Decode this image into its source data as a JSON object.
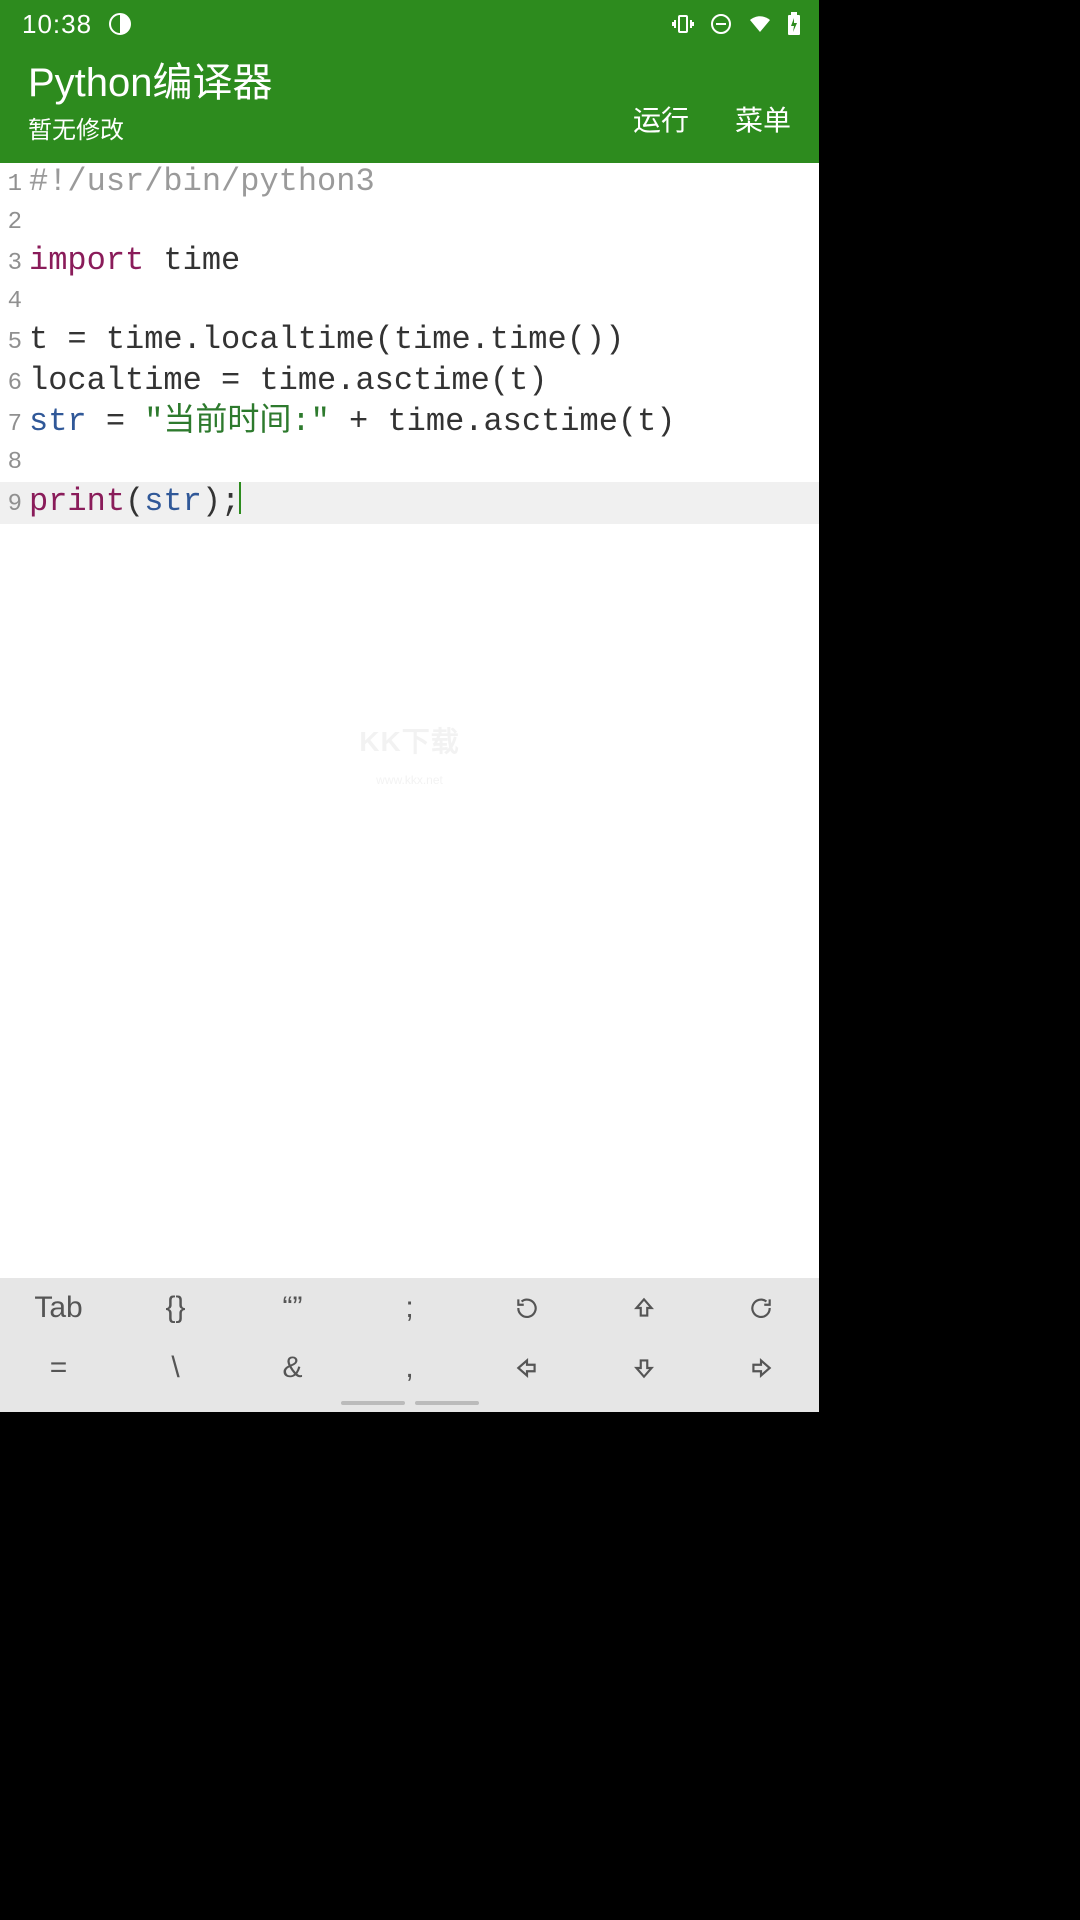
{
  "status": {
    "time": "10:38"
  },
  "header": {
    "title": "Python编译器",
    "subtitle": "暂无修改",
    "run": "运行",
    "menu": "菜单"
  },
  "code": {
    "current_line": 9,
    "lines": [
      {
        "n": 1,
        "tokens": [
          {
            "t": "#!/usr/bin/python3",
            "c": "comment"
          }
        ]
      },
      {
        "n": 2,
        "tokens": []
      },
      {
        "n": 3,
        "tokens": [
          {
            "t": "import",
            "c": "keyword"
          },
          {
            "t": " ",
            "c": "default"
          },
          {
            "t": "time",
            "c": "default"
          }
        ]
      },
      {
        "n": 4,
        "tokens": []
      },
      {
        "n": 5,
        "tokens": [
          {
            "t": "t = time.localtime(time.time())",
            "c": "default"
          }
        ]
      },
      {
        "n": 6,
        "tokens": [
          {
            "t": "localtime = time.asctime(t)",
            "c": "default"
          }
        ]
      },
      {
        "n": 7,
        "tokens": [
          {
            "t": "str",
            "c": "builtin"
          },
          {
            "t": " = ",
            "c": "default"
          },
          {
            "t": "\"当前时间:\"",
            "c": "string"
          },
          {
            "t": " + time.asctime(t)",
            "c": "default"
          }
        ]
      },
      {
        "n": 8,
        "tokens": []
      },
      {
        "n": 9,
        "tokens": [
          {
            "t": "print",
            "c": "func"
          },
          {
            "t": "(",
            "c": "default"
          },
          {
            "t": "str",
            "c": "builtin"
          },
          {
            "t": ");",
            "c": "default"
          }
        ]
      }
    ]
  },
  "keys": {
    "row1": [
      "Tab",
      "{}",
      "“”",
      ";",
      "↺",
      "⇧",
      "↻"
    ],
    "row2": [
      "=",
      "\\",
      "&",
      ",",
      "⇦",
      "⇩",
      "⇨"
    ]
  },
  "watermark": {
    "top": "KK下载",
    "bot": "www.kkx.net"
  }
}
